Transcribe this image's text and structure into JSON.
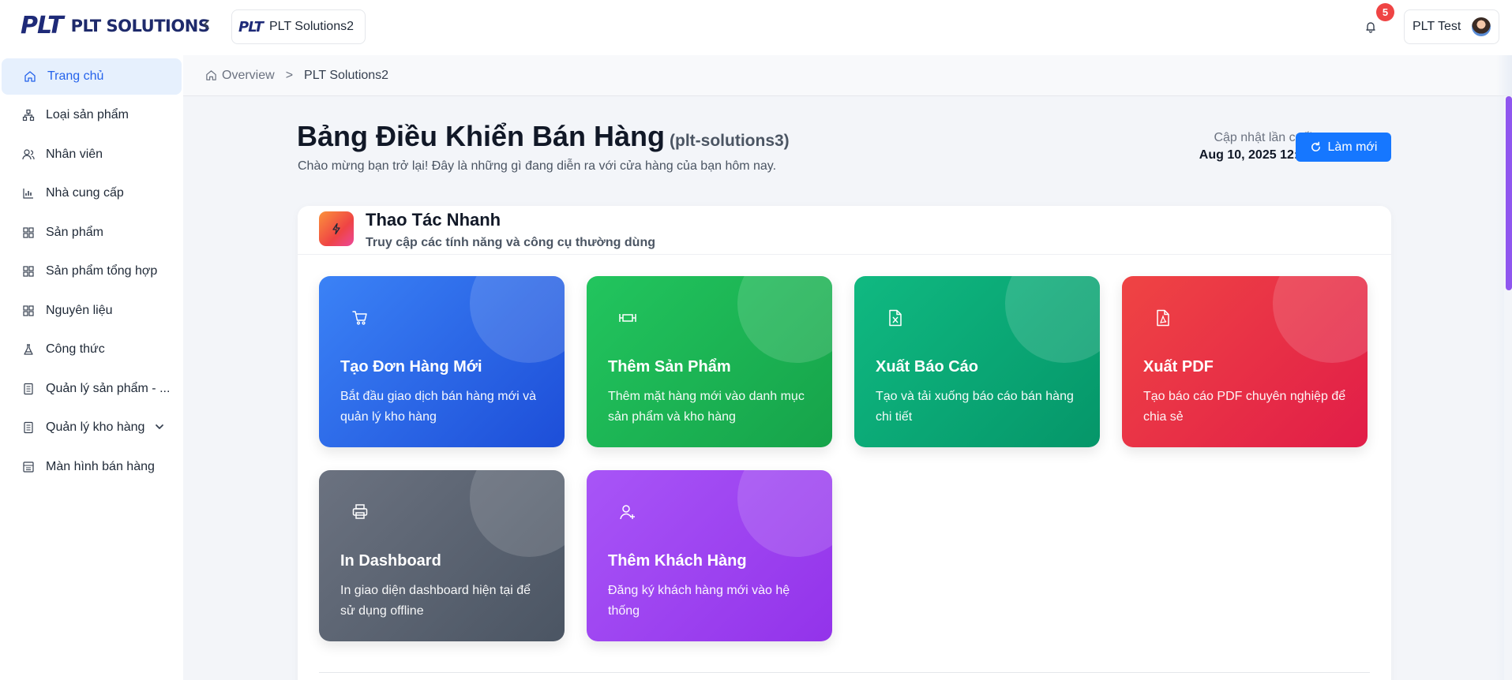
{
  "header": {
    "brand_logo": "PLT",
    "brand_name": "PLT SOLUTIONS",
    "store_logo": "PLT",
    "store_name": "PLT Solutions2",
    "notification_count": "5",
    "user_name": "PLT Test"
  },
  "sidebar": {
    "items": [
      {
        "label": "Trang chủ",
        "icon": "home-icon",
        "active": true
      },
      {
        "label": "Loại sản phẩm",
        "icon": "sitemap-icon"
      },
      {
        "label": "Nhân viên",
        "icon": "users-icon"
      },
      {
        "label": "Nhà cung cấp",
        "icon": "bar-chart-icon"
      },
      {
        "label": "Sản phẩm",
        "icon": "grid-icon"
      },
      {
        "label": "Sản phẩm tổng hợp",
        "icon": "grid-icon"
      },
      {
        "label": "Nguyên liệu",
        "icon": "grid-icon"
      },
      {
        "label": "Công thức",
        "icon": "flask-icon"
      },
      {
        "label": "Quản lý sản phẩm - ...",
        "icon": "document-icon"
      },
      {
        "label": "Quản lý kho hàng",
        "icon": "document-icon",
        "expandable": true
      },
      {
        "label": "Màn hình bán hàng",
        "icon": "pos-icon"
      }
    ]
  },
  "breadcrumb": {
    "home": "Overview",
    "separator": ">",
    "current": "PLT Solutions2"
  },
  "main": {
    "title": "Bảng Điều Khiển Bán Hàng",
    "title_suffix": "(plt-solutions3)",
    "description": "Chào mừng bạn trở lại! Đây là những gì đang diễn ra với cửa hàng của bạn hôm nay.",
    "updated_label": "Cập nhật lần cuối",
    "updated_value": "Aug 10, 2025 12:46",
    "refresh_label": "Làm mới"
  },
  "quick_actions": {
    "title": "Thao Tác Nhanh",
    "subtitle": "Truy cập các tính năng và công cụ thường dùng",
    "cards": [
      {
        "title": "Tạo Đơn Hàng Mới",
        "desc": "Bắt đầu giao dịch bán hàng mới và quản lý kho hàng",
        "icon": "cart-icon",
        "color": "#2563eb"
      },
      {
        "title": "Thêm Sản Phẩm",
        "desc": "Thêm mặt hàng mới vào danh mục sản phẩm và kho hàng",
        "icon": "product-add-icon",
        "color": "#16a34a"
      },
      {
        "title": "Xuất Báo Cáo",
        "desc": "Tạo và tải xuống báo cáo bán hàng chi tiết",
        "icon": "excel-file-icon",
        "color": "#059669"
      },
      {
        "title": "Xuất PDF",
        "desc": "Tạo báo cáo PDF chuyên nghiệp để chia sẻ",
        "icon": "pdf-file-icon",
        "color": "#e11d48"
      },
      {
        "title": "In Dashboard",
        "desc": "In giao diện dashboard hiện tại để sử dụng offline",
        "icon": "printer-icon",
        "color": "#4b5563"
      },
      {
        "title": "Thêm Khách Hàng",
        "desc": "Đăng ký khách hàng mới vào hệ thống",
        "icon": "user-add-icon",
        "color": "#9333ea"
      }
    ]
  }
}
